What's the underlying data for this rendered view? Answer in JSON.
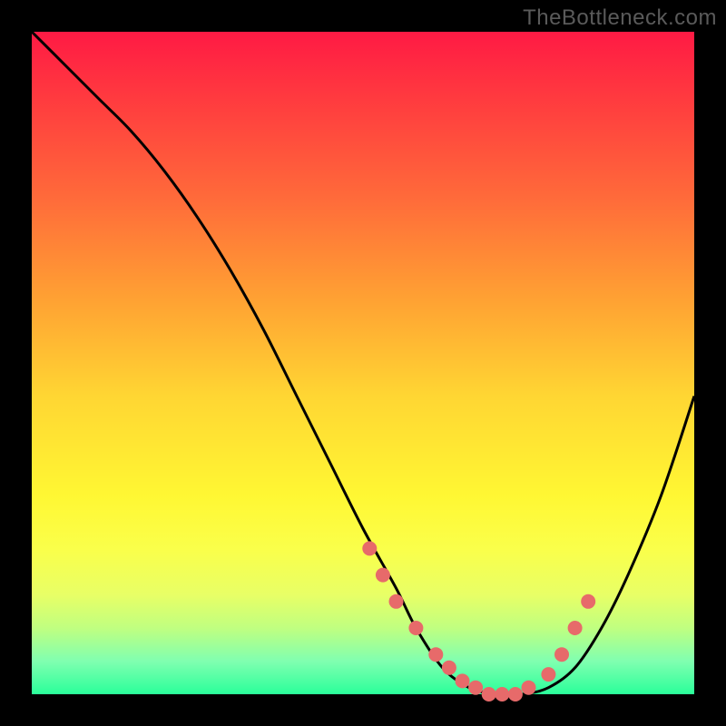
{
  "watermark": "TheBottleneck.com",
  "chart_data": {
    "type": "line",
    "title": "",
    "xlabel": "",
    "ylabel": "",
    "xlim": [
      0,
      100
    ],
    "ylim": [
      0,
      100
    ],
    "background_gradient": {
      "top": "#ff1a44",
      "mid": "#fff733",
      "bottom": "#2aff9a"
    },
    "series": [
      {
        "name": "bottleneck-curve",
        "color": "#000000",
        "x": [
          0,
          5,
          10,
          15,
          20,
          25,
          30,
          35,
          40,
          45,
          50,
          55,
          58,
          62,
          66,
          70,
          74,
          78,
          82,
          86,
          90,
          95,
          100
        ],
        "y": [
          100,
          95,
          90,
          85,
          79,
          72,
          64,
          55,
          45,
          35,
          25,
          16,
          10,
          4,
          1,
          0,
          0,
          1,
          4,
          10,
          18,
          30,
          45
        ]
      }
    ],
    "markers": {
      "name": "highlight-dots",
      "color": "#e76a6a",
      "radius_px": 8,
      "x": [
        51,
        53,
        55,
        58,
        61,
        63,
        65,
        67,
        69,
        71,
        73,
        75,
        78,
        80,
        82,
        84
      ],
      "y": [
        22,
        18,
        14,
        10,
        6,
        4,
        2,
        1,
        0,
        0,
        0,
        1,
        3,
        6,
        10,
        14
      ]
    }
  }
}
